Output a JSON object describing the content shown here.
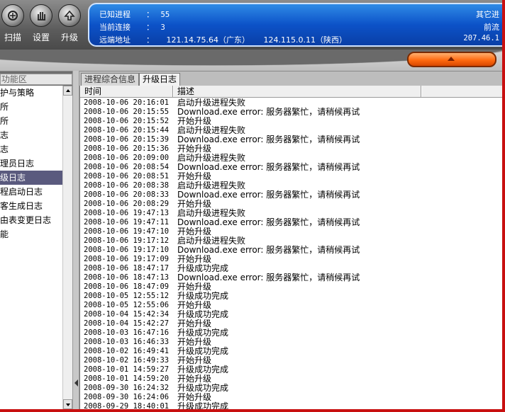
{
  "toolbar": {
    "buttons": [
      {
        "label": "扫描",
        "icon": "scan-icon"
      },
      {
        "label": "设置",
        "icon": "settings-hand-icon"
      },
      {
        "label": "升级",
        "icon": "upgrade-arrow-icon"
      }
    ]
  },
  "info": {
    "known_process_label": "已知进程",
    "known_process_sep": "：",
    "known_process_value": "55",
    "current_conn_label": "当前连接",
    "current_conn_sep": "：",
    "current_conn_value": "3",
    "remote_addr_label": "远端地址",
    "remote_addr_sep": "：",
    "remote_addr_1": "121.14.75.64（广东）",
    "remote_addr_2": "124.115.0.11（陕西）",
    "right_1": "其它进",
    "right_2": "前流",
    "right_3": "207.46.1"
  },
  "colors": {
    "info_panel": "#0c52c8",
    "selected_item": "#5a5a7e",
    "orange_button": "#ff6a10",
    "frame_border": "#c81010"
  },
  "left_panel": {
    "header": "功能区",
    "selected_index": 6,
    "items": [
      "护与策略",
      "所",
      "所",
      "志",
      "志",
      "理员日志",
      "级日志",
      "程启动日志",
      "客生成日志",
      "由表变更日志",
      "能"
    ]
  },
  "tabs": [
    {
      "label": "进程综合信息",
      "active": false
    },
    {
      "label": "升级日志",
      "active": true
    }
  ],
  "grid": {
    "columns": [
      "时间",
      "描述"
    ],
    "rows": [
      [
        "2008-10-06 20:16:01",
        "启动升级进程失败"
      ],
      [
        "2008-10-06 20:15:55",
        "Download.exe error: 服务器繁忙，请稍候再试"
      ],
      [
        "2008-10-06 20:15:52",
        "开始升级"
      ],
      [
        "2008-10-06 20:15:44",
        "启动升级进程失败"
      ],
      [
        "2008-10-06 20:15:39",
        "Download.exe error: 服务器繁忙，请稍候再试"
      ],
      [
        "2008-10-06 20:15:36",
        "开始升级"
      ],
      [
        "2008-10-06 20:09:00",
        "启动升级进程失败"
      ],
      [
        "2008-10-06 20:08:54",
        "Download.exe error: 服务器繁忙，请稍候再试"
      ],
      [
        "2008-10-06 20:08:51",
        "开始升级"
      ],
      [
        "2008-10-06 20:08:38",
        "启动升级进程失败"
      ],
      [
        "2008-10-06 20:08:33",
        "Download.exe error: 服务器繁忙，请稍候再试"
      ],
      [
        "2008-10-06 20:08:29",
        "开始升级"
      ],
      [
        "2008-10-06 19:47:13",
        "启动升级进程失败"
      ],
      [
        "2008-10-06 19:47:11",
        "Download.exe error: 服务器繁忙，请稍候再试"
      ],
      [
        "2008-10-06 19:47:10",
        "开始升级"
      ],
      [
        "2008-10-06 19:17:12",
        "启动升级进程失败"
      ],
      [
        "2008-10-06 19:17:10",
        "Download.exe error: 服务器繁忙，请稍候再试"
      ],
      [
        "2008-10-06 19:17:09",
        "开始升级"
      ],
      [
        "2008-10-06 18:47:17",
        "升级成功完成"
      ],
      [
        "2008-10-06 18:47:13",
        "Download.exe error: 服务器繁忙，请稍候再试"
      ],
      [
        "2008-10-06 18:47:09",
        "开始升级"
      ],
      [
        "2008-10-05 12:55:12",
        "升级成功完成"
      ],
      [
        "2008-10-05 12:55:06",
        "开始升级"
      ],
      [
        "2008-10-04 15:42:34",
        "升级成功完成"
      ],
      [
        "2008-10-04 15:42:27",
        "开始升级"
      ],
      [
        "2008-10-03 16:47:16",
        "升级成功完成"
      ],
      [
        "2008-10-03 16:46:33",
        "开始升级"
      ],
      [
        "2008-10-02 16:49:41",
        "升级成功完成"
      ],
      [
        "2008-10-02 16:49:33",
        "开始升级"
      ],
      [
        "2008-10-01 14:59:27",
        "升级成功完成"
      ],
      [
        "2008-10-01 14:59:20",
        "开始升级"
      ],
      [
        "2008-09-30 16:24:32",
        "升级成功完成"
      ],
      [
        "2008-09-30 16:24:06",
        "开始升级"
      ],
      [
        "2008-09-29 18:40:01",
        "升级成功完成"
      ]
    ]
  }
}
